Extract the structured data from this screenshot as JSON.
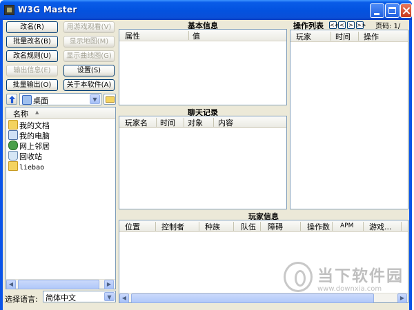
{
  "window": {
    "title": "W3G Master"
  },
  "buttons": {
    "rename": "改名(R)",
    "batch_rename": "批量改名(B)",
    "rename_rules": "改名规则(U)",
    "output_info": "输出信息(E)",
    "batch_output": "批量输出(O)",
    "watch_with_game": "用游戏观看(V)",
    "show_map": "显示地图(M)",
    "show_curve": "显示曲线图(G)",
    "settings": "设置(S)",
    "about": "关于本软件(A)"
  },
  "location": {
    "value": "桌面"
  },
  "file_tree": {
    "column_name": "名称",
    "items": [
      {
        "label": "我的文档",
        "icon": "my-documents-icon"
      },
      {
        "label": "我的电脑",
        "icon": "my-computer-icon"
      },
      {
        "label": "网上邻居",
        "icon": "network-icon"
      },
      {
        "label": "回收站",
        "icon": "recycle-bin-icon"
      },
      {
        "label": "liebao",
        "icon": "folder-icon"
      }
    ]
  },
  "language": {
    "label": "选择语言:",
    "value": "简体中文"
  },
  "basic_info": {
    "title": "基本信息",
    "columns": [
      "属性",
      "值"
    ]
  },
  "chat_log": {
    "title": "聊天记录",
    "columns": [
      "玩家名",
      "时间",
      "对象",
      "内容"
    ]
  },
  "action_list": {
    "title": "操作列表",
    "page_label": "页码: 1/",
    "columns": [
      "玩家",
      "时间",
      "操作"
    ]
  },
  "player_info": {
    "title": "玩家信息",
    "columns": [
      "位置",
      "控制者",
      "种族",
      "队伍",
      "障碍",
      "操作数",
      "APM",
      "游戏..."
    ]
  },
  "watermark": {
    "text": "当下软件园",
    "url": "www.downxia.com"
  }
}
